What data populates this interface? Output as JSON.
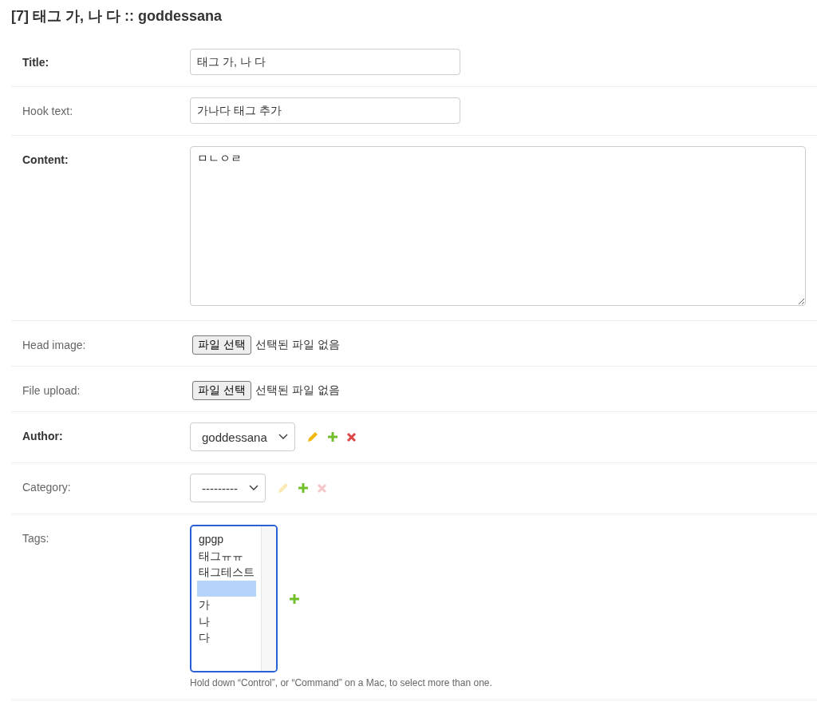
{
  "heading": "[7] 태그 가, 나 다 :: goddessana",
  "fields": [
    {
      "kind": "text",
      "label": "Title:",
      "required": true,
      "value": "태그 가, 나 다"
    },
    {
      "kind": "text",
      "label": "Hook text:",
      "required": false,
      "value": "가나다 태그 추가"
    },
    {
      "kind": "textarea",
      "label": "Content:",
      "required": true,
      "value": "ㅁㄴㅇㄹ"
    },
    {
      "kind": "file",
      "label": "Head image:",
      "required": false,
      "button": "파일 선택",
      "status": "선택된 파일 없음"
    },
    {
      "kind": "file",
      "label": "File upload:",
      "required": false,
      "button": "파일 선택",
      "status": "선택된 파일 없음"
    },
    {
      "kind": "select",
      "label": "Author:",
      "required": true,
      "value": "goddessana",
      "actions": [
        {
          "kind": "edit",
          "disabled": false
        },
        {
          "kind": "add",
          "disabled": false
        },
        {
          "kind": "delete",
          "disabled": false
        }
      ]
    },
    {
      "kind": "select",
      "label": "Category:",
      "required": false,
      "value": "---------",
      "actions": [
        {
          "kind": "edit",
          "disabled": true
        },
        {
          "kind": "add",
          "disabled": false
        },
        {
          "kind": "delete",
          "disabled": true
        }
      ]
    },
    {
      "kind": "multiselect",
      "label": "Tags:",
      "required": false,
      "options": [
        {
          "label": "gpgp",
          "selected": false
        },
        {
          "label": "태그ㅠㅠ",
          "selected": false
        },
        {
          "label": "태그테스트",
          "selected": false
        },
        {
          "selected": true
        },
        {
          "label": "가",
          "selected": false
        },
        {
          "label": "나",
          "selected": false
        },
        {
          "label": "다",
          "selected": false
        }
      ],
      "actions": [
        {
          "kind": "add",
          "disabled": false
        }
      ],
      "help": "Hold down “Control”, or “Command” on a Mac, to select more than one."
    }
  ]
}
